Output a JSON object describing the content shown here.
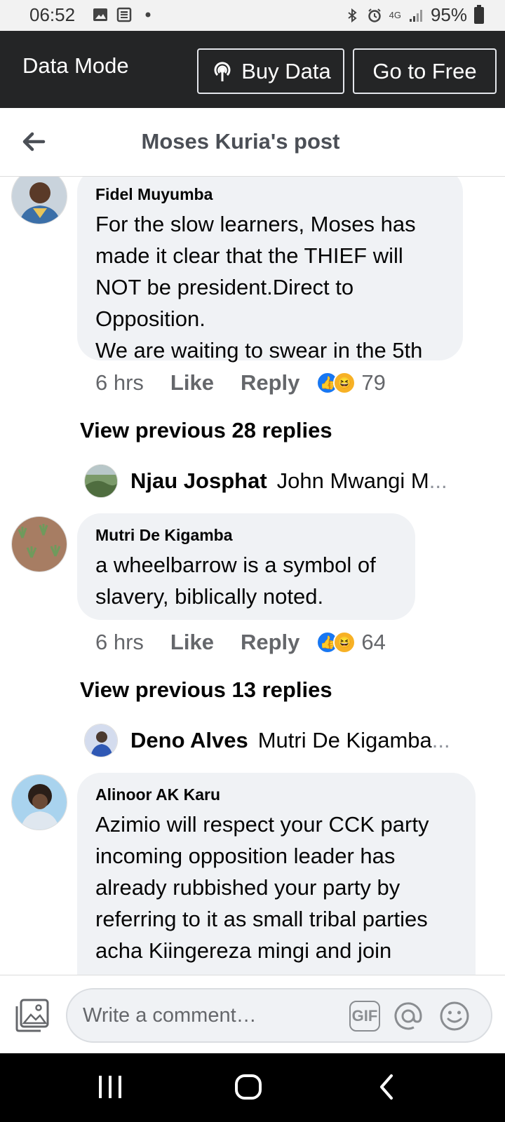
{
  "status_bar": {
    "time": "06:52",
    "network": "4G",
    "battery": "95%"
  },
  "data_mode": {
    "label": "Data Mode",
    "buy_data": "Buy Data",
    "go_free": "Go to Free"
  },
  "header": {
    "title": "Moses Kuria's post",
    "back_icon": "back-arrow-icon"
  },
  "comments": [
    {
      "author": "Fidel Muyumba",
      "text": "For the slow learners, Moses has\nmade it clear that the THIEF will\nNOT be president.Direct to\nOpposition.\nWe are waiting to swear in the 5th",
      "time": "6 hrs",
      "like": "Like",
      "reply": "Reply",
      "reactions": [
        "like",
        "haha"
      ],
      "reaction_count": "79",
      "view_previous": "View previous 28 replies",
      "latest_reply": {
        "name": "Njau Josphat",
        "snippet": "John Mwangi M",
        "ellipsis": "..."
      }
    },
    {
      "author": "Mutri De Kigamba",
      "text": "a wheelbarrow is a symbol of\nslavery, biblically noted.",
      "time": "6 hrs",
      "like": "Like",
      "reply": "Reply",
      "reactions": [
        "like",
        "haha"
      ],
      "reaction_count": "64",
      "view_previous": "View previous 13 replies",
      "latest_reply": {
        "name": "Deno Alves",
        "snippet": "Mutri De Kigamba",
        "ellipsis": " ..."
      }
    },
    {
      "author": "Alinoor AK Karu",
      "text": "Azimio will respect your CCK party\nincoming opposition leader has\nalready rubbished your party by\nreferring to it as small tribal parties\nacha Kiingereza mingi and join"
    }
  ],
  "composer": {
    "placeholder": "Write a comment…",
    "gif_label": "GIF"
  },
  "colors": {
    "data_bar_bg": "#242526",
    "bubble_bg": "#f0f2f5",
    "like_blue": "#1877f2",
    "haha_yellow": "#f7b125",
    "meta_gray": "#65676b"
  }
}
